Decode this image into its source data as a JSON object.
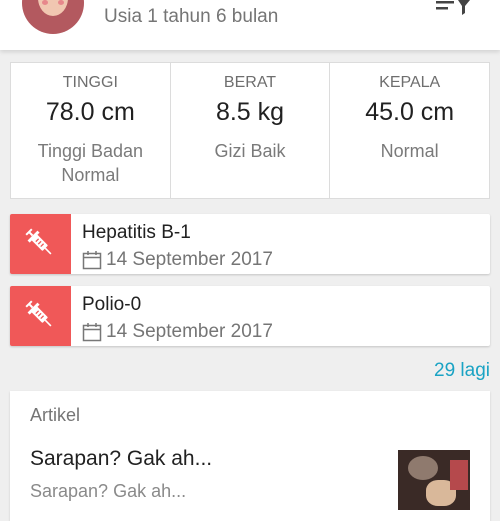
{
  "profile": {
    "age": "Usia 1 tahun 6 bulan"
  },
  "stats": [
    {
      "label": "TINGGI",
      "value": "78.0 cm",
      "note": "Tinggi Badan Normal"
    },
    {
      "label": "BERAT",
      "value": "8.5 kg",
      "note": "Gizi Baik"
    },
    {
      "label": "KEPALA",
      "value": "45.0 cm",
      "note": "Normal"
    }
  ],
  "vaccinations": [
    {
      "name": "Hepatitis B-1",
      "date": "14 September 2017",
      "icon": "syringe-icon"
    },
    {
      "name": "Polio-0",
      "date": "14 September 2017",
      "icon": "syringe-icon"
    }
  ],
  "more_label": "29 lagi",
  "article": {
    "header": "Artikel",
    "title": "Sarapan? Gak ah...",
    "subtitle": "Sarapan? Gak ah..."
  },
  "colors": {
    "accent_red": "#f05858",
    "link_blue": "#1aa3c4"
  }
}
